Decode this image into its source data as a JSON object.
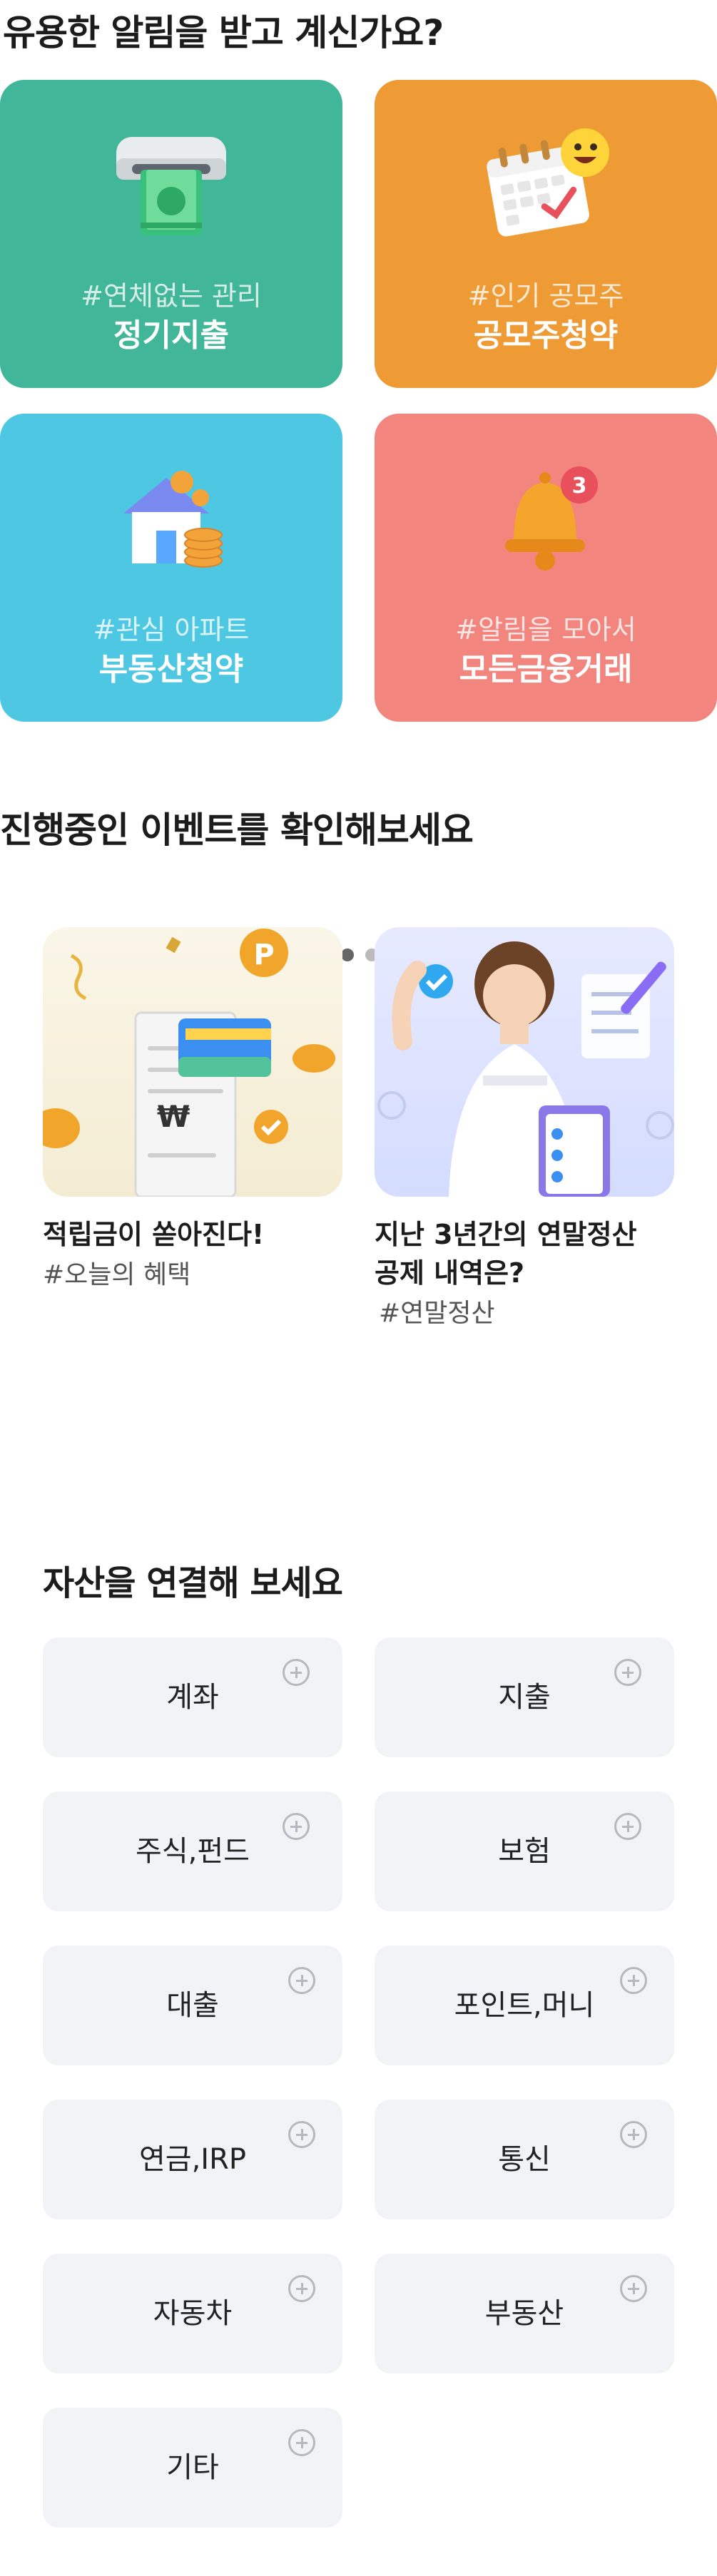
{
  "alerts": {
    "heading": "유용한 알림을 받고 계신가요?",
    "cards": [
      {
        "tag": "#연체없는 관리",
        "title": "정기지출",
        "color": "#41b698",
        "icon": "atm-cash-icon"
      },
      {
        "tag": "#인기 공모주",
        "title": "공모주청약",
        "color": "#ef9b35",
        "icon": "calendar-emoji-icon"
      },
      {
        "tag": "#관심 아파트",
        "title": "부동산청약",
        "color": "#4dc7e2",
        "icon": "house-coins-icon"
      },
      {
        "tag": "#알림을 모아서",
        "title": "모든금융거래",
        "color": "#f2857e",
        "icon": "bell-badge-icon"
      }
    ],
    "bell_badge": "3"
  },
  "events": {
    "heading": "진행중인 이벤트를 확인해보세요",
    "items": [
      {
        "title": "적립금이 쏟아진다!",
        "tag": "#오늘의 혜택",
        "image": "receipt-coins-illustration"
      },
      {
        "title_line1": "지난 3년간의 연말정산",
        "title_line2": "공제 내역은?",
        "tag": "#연말정산",
        "image": "woman-document-illustration"
      }
    ],
    "receipt_symbol": "₩"
  },
  "assets": {
    "heading": "자산을 연결해 보세요",
    "items": [
      "계좌",
      "지출",
      "주식,펀드",
      "보험",
      "대출",
      "포인트,머니",
      "연금,IRP",
      "통신",
      "자동차",
      "부동산",
      "기타"
    ]
  }
}
